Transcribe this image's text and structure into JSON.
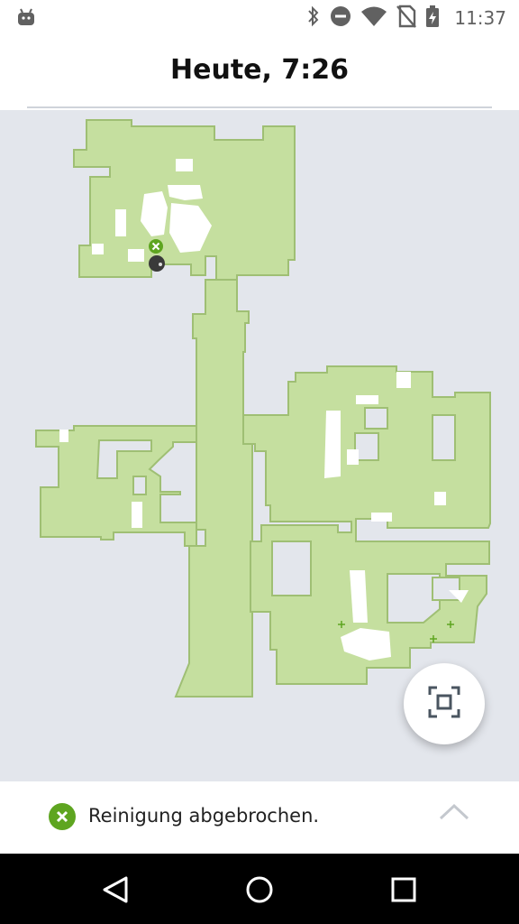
{
  "status_bar": {
    "time": "11:37",
    "left_icon": "android-notification-icon",
    "icons": [
      "bluetooth-icon",
      "do-not-disturb-icon",
      "wifi-icon",
      "no-sim-icon",
      "battery-charging-icon"
    ]
  },
  "header": {
    "title": "Heute, 7:26"
  },
  "map": {
    "colors": {
      "background": "#e3e6ec",
      "cleaned_area": "#c5df9f",
      "area_border": "#9fbf74",
      "obstacle": "#ffffff",
      "accent_green": "#5ea520"
    },
    "markers": [
      "cleaning-stopped-icon",
      "robot-position-icon",
      "waypoint-plus-icon"
    ]
  },
  "fit_button": {
    "icon": "fit-to-screen-icon"
  },
  "bottom_panel": {
    "status_text": "Reinigung abgebrochen.",
    "status_icon": "cancel-circle-icon",
    "expand_icon": "chevron-up-icon"
  },
  "nav_bar": {
    "items": [
      "back-icon",
      "home-icon",
      "recents-icon"
    ]
  }
}
